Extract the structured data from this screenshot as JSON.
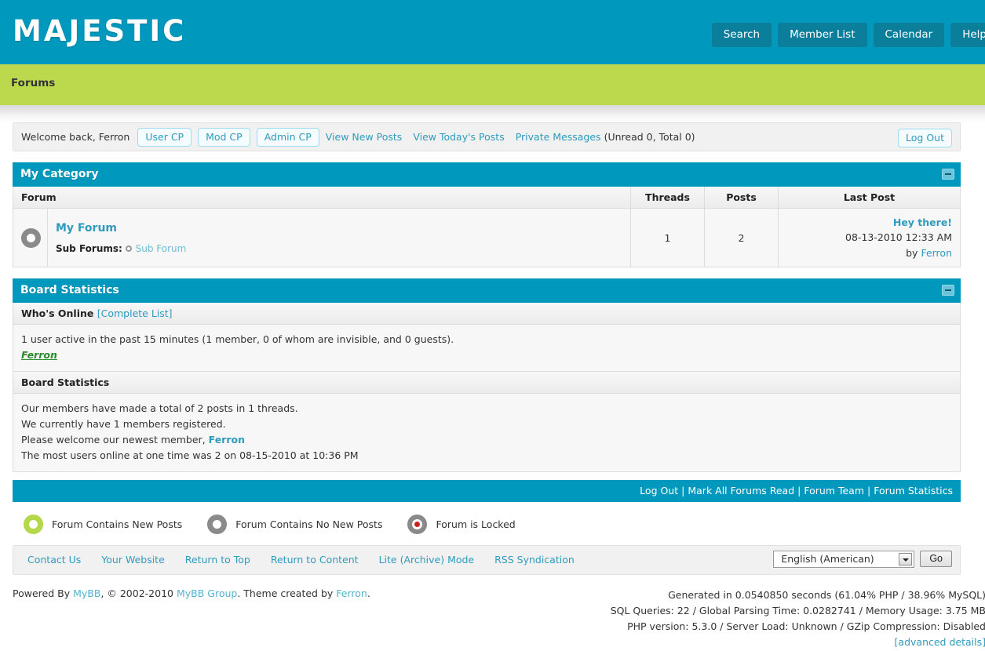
{
  "header": {
    "logo": "MAJESTIC",
    "nav": [
      {
        "label": "Search"
      },
      {
        "label": "Member List"
      },
      {
        "label": "Calendar"
      },
      {
        "label": "Help"
      }
    ]
  },
  "breadcrumb": {
    "label": "Forums"
  },
  "welcome": {
    "greeting": "Welcome back, Ferron",
    "user_cp": "User CP",
    "mod_cp": "Mod CP",
    "admin_cp": "Admin CP",
    "view_new_posts": "View New Posts",
    "view_todays_posts": "View Today's Posts",
    "private_messages": "Private Messages",
    "pm_counts": "(Unread 0, Total 0)",
    "log_out": "Log Out"
  },
  "category": {
    "title": "My Category",
    "columns": {
      "forum": "Forum",
      "threads": "Threads",
      "posts": "Posts",
      "last_post": "Last Post"
    },
    "rows": [
      {
        "icon": "forum-no-new-posts-icon",
        "name": "My Forum",
        "sub_forums_label": "Sub Forums:",
        "sub_forums": [
          {
            "name": "Sub Forum"
          }
        ],
        "threads": "1",
        "posts": "2",
        "last_post_title": "Hey there!",
        "last_post_date": "08-13-2010 12:33 AM",
        "last_post_by_prefix": "by",
        "last_post_author": "Ferron"
      }
    ]
  },
  "board_statistics": {
    "title": "Board Statistics",
    "whos_online_label": "Who's Online",
    "complete_list": "[Complete List]",
    "online_summary": "1 user active in the past 15 minutes (1 member, 0 of whom are invisible, and 0 guests).",
    "online_users": [
      {
        "name": "Ferron"
      }
    ],
    "stats_label": "Board Statistics",
    "stats_lines": [
      "Our members have made a total of 2 posts in 1 threads.",
      "We currently have 1 members registered."
    ],
    "welcome_prefix": "Please welcome our newest member,",
    "newest_member": "Ferron",
    "most_users_line": "The most users online at one time was 2 on 08-15-2010 at 10:36 PM"
  },
  "action_bar": {
    "links": [
      {
        "label": "Log Out"
      },
      {
        "label": "Mark All Forums Read"
      },
      {
        "label": "Forum Team"
      },
      {
        "label": "Forum Statistics"
      }
    ],
    "separator": "|"
  },
  "legend": [
    {
      "icon": "forum-new-posts-icon",
      "label": "Forum Contains New Posts"
    },
    {
      "icon": "forum-no-new-posts-icon",
      "label": "Forum Contains No New Posts"
    },
    {
      "icon": "forum-locked-icon",
      "label": "Forum is Locked"
    }
  ],
  "footer": {
    "links": [
      {
        "label": "Contact Us"
      },
      {
        "label": "Your Website"
      },
      {
        "label": "Return to Top"
      },
      {
        "label": "Return to Content"
      },
      {
        "label": "Lite (Archive) Mode"
      },
      {
        "label": "RSS Syndication"
      }
    ],
    "language_selected": "English (American)",
    "go_label": "Go"
  },
  "credits": {
    "powered_prefix": "Powered By",
    "mybb": "MyBB",
    "copyright": ", © 2002-2010",
    "mybb_group": "MyBB Group",
    "theme_prefix": ". Theme created by",
    "theme_author": "Ferron",
    "theme_suffix": ".",
    "generated": "Generated in 0.0540850 seconds (61.04% PHP / 38.96% MySQL)",
    "queries": "SQL Queries: 22 / Global Parsing Time: 0.0282741 / Memory Usage: 3.75 MB",
    "php": "PHP version: 5.3.0 / Server Load: Unknown / GZip Compression: Disabled",
    "advanced": "[advanced details]"
  }
}
